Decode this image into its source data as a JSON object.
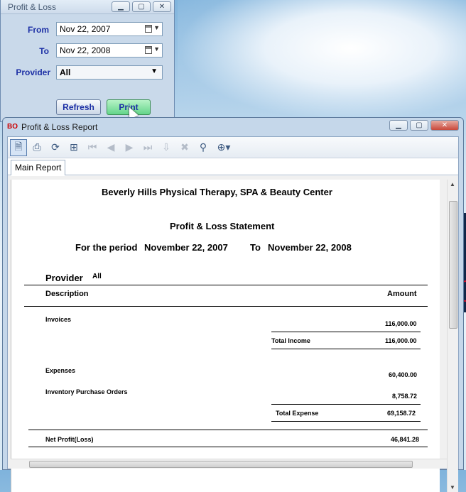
{
  "filter_window": {
    "title": "Profit & Loss",
    "from_label": "From",
    "from_value": "Nov 22, 2007",
    "to_label": "To",
    "to_value": "Nov 22, 2008",
    "provider_label": "Provider",
    "provider_value": "All",
    "refresh_label": "Refresh",
    "print_label": "Print"
  },
  "report_window": {
    "title": "Profit & Loss Report",
    "tab_label": "Main Report"
  },
  "report": {
    "company": "Beverly Hills Physical Therapy, SPA & Beauty Center",
    "statement_title": "Profit & Loss Statement",
    "period_prefix": "For the period",
    "period_from": "November 22, 2007",
    "period_to_word": "To",
    "period_to": "November 22, 2008",
    "provider_label": "Provider",
    "provider_value": "All",
    "col_description": "Description",
    "col_amount": "Amount",
    "invoices_label": "Invoices",
    "invoices_amount": "116,000.00",
    "total_income_label": "Total Income",
    "total_income_amount": "116,000.00",
    "expenses_label": "Expenses",
    "expenses_amount": "60,400.00",
    "ipo_label": "Inventory Purchase Orders",
    "ipo_amount": "8,758.72",
    "total_expense_label": "Total Expense",
    "total_expense_amount": "69,158.72",
    "net_profit_label": "Net Profit(Loss)",
    "net_profit_amount": "46,841.28"
  }
}
